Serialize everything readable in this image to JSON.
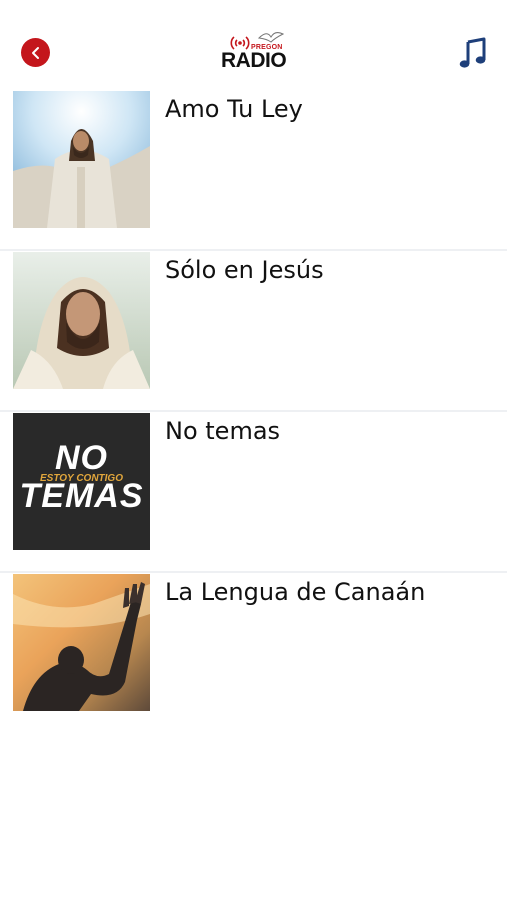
{
  "header": {
    "back_icon": "chevron-left-icon",
    "logo": {
      "top_text": "PREGON",
      "main_text": "RADIO"
    },
    "music_icon": "music-note-icon",
    "accent_color": "#c4161c",
    "music_color": "#1e3f7a"
  },
  "songs": [
    {
      "title": "Amo Tu Ley",
      "thumbnail": "arms-raised-robed-figure"
    },
    {
      "title": "Sólo en Jesús",
      "thumbnail": "hooded-robed-figure-portrait"
    },
    {
      "title": "No temas",
      "thumbnail": "no-temas-text-artwork",
      "art_text": {
        "line1": "NO",
        "line2": "ESTOY CONTIGO",
        "line3": "TEMAS"
      }
    },
    {
      "title": "La Lengua de Canaán",
      "thumbnail": "silhouette-raised-hand-sunset"
    }
  ]
}
